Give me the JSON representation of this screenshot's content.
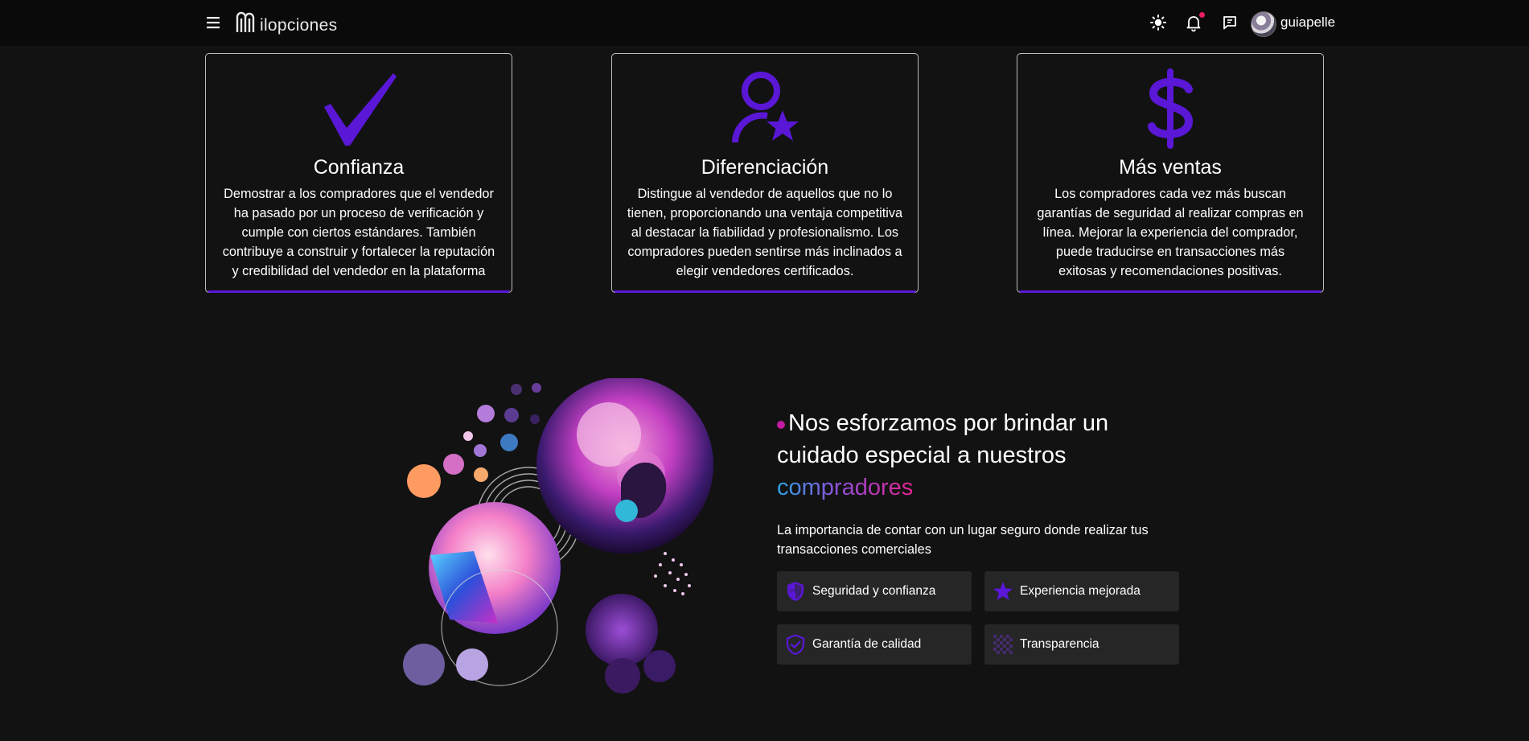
{
  "header": {
    "logo_text": "ilopciones",
    "username": "guiapelle",
    "icons": [
      "menu-icon",
      "sun-icon",
      "bell-icon",
      "chat-icon"
    ],
    "notification_dot_color": "#e91e63"
  },
  "cards": [
    {
      "icon": "checkmark-icon",
      "title": "Confianza",
      "text": "Demostrar a los compradores que el vendedor ha pasado por un proceso de verificación y cumple con ciertos estándares. También contribuye a construir y fortalecer la reputación y credibilidad del vendedor en la plataforma"
    },
    {
      "icon": "user-star-icon",
      "title": "Diferenciación",
      "text": "Distingue al vendedor de aquellos que no lo tienen, proporcionando una ventaja competitiva al destacar la fiabilidad y profesionalismo. Los compradores pueden sentirse más inclinados a elegir vendedores certificados."
    },
    {
      "icon": "dollar-icon",
      "title": "Más ventas",
      "text": "Los compradores cada vez más buscan garantías de seguridad al realizar compras en línea. Mejorar la experiencia del comprador, puede traducirse en transacciones más exitosas y recomendaciones positivas."
    }
  ],
  "promo": {
    "headline": "Nos esforzamos por brindar un cuidado especial a nuestros",
    "highlight": "compradores",
    "subtitle": "La importancia de contar con un lugar seguro donde realizar tus transacciones comerciales",
    "features": [
      {
        "icon": "shield-half-icon",
        "label": "Seguridad y confianza"
      },
      {
        "icon": "star-icon",
        "label": "Experiencia mejorada"
      },
      {
        "icon": "shield-check-icon",
        "label": "Garantía de calidad"
      },
      {
        "icon": "checker-pattern-icon",
        "label": "Transparencia"
      }
    ]
  },
  "colors": {
    "accent": "#5a17d6",
    "background": "#121212",
    "topbar": "#0a0a0a",
    "feature_bg": "#262626"
  }
}
